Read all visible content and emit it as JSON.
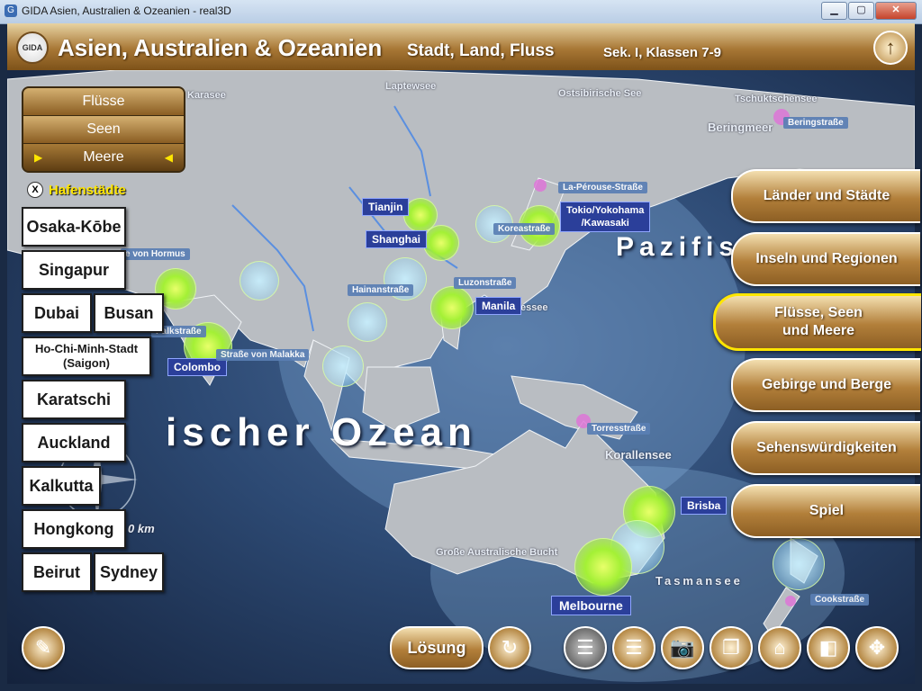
{
  "window": {
    "title": "GIDA Asien, Australien & Ozeanien - real3D",
    "minimize": "▁",
    "maximize": "▢",
    "close": "✕"
  },
  "header": {
    "logo": "GIDA",
    "title": "Asien, Australien & Ozeanien",
    "subtitle": "Stadt, Land, Fluss",
    "level": "Sek. I, Klassen 7-9",
    "up_icon": "↑"
  },
  "filters": {
    "items": [
      "Flüsse",
      "Seen",
      "Meere"
    ],
    "active": "Meere",
    "arrow_left": "▶",
    "arrow_right": "◀"
  },
  "category": {
    "close": "X",
    "label": "Hafenstädte"
  },
  "answers": {
    "osaka": "Osaka-Kōbe",
    "singapur": "Singapur",
    "dubai": "Dubai",
    "busan": "Busan",
    "hochiminh": "Ho-Chi-Minh-Stadt\n(Saigon)",
    "karatschi": "Karatschi",
    "auckland": "Auckland",
    "kalkutta": "Kalkutta",
    "hongkong": "Hongkong",
    "beirut": "Beirut",
    "sydney": "Sydney"
  },
  "nav": {
    "laender": "Länder und Städte",
    "inseln": "Inseln und Regionen",
    "fluesse": "Flüsse, Seen\nund Meere",
    "gebirge": "Gebirge und Berge",
    "sehens": "Sehenswürdigkeiten",
    "spiel": "Spiel",
    "active": "Flüsse, Seen und Meere"
  },
  "map": {
    "cities": {
      "tianjin": "Tianjin",
      "shanghai": "Shanghai",
      "tokio": "Tokio/Yokohama\n/Kawasaki",
      "manila": "Manila",
      "colombo": "Colombo",
      "brisbane": "Brisba",
      "melbourne": "Melbourne"
    },
    "straits": {
      "laperouse": "La-Pérouse-Straße",
      "korea": "Koreastraße",
      "luzon": "Luzonstraße",
      "hainan": "Hainanstraße",
      "hormus": "e von Hormus",
      "palk": "Palkstraße",
      "malakka": "Straße von Malakka",
      "torres": "Torresstraße",
      "cook": "Cookstraße"
    },
    "labels": {
      "laptew": "Laptewsee",
      "karasee": "Karasee",
      "ostsib": "Ostsibirische See",
      "tschuk": "Tschuktschensee",
      "bering_strait": "Beringstraße",
      "bering_sea": "Beringmeer",
      "korallen": "Korallensee",
      "tasman": "Tasmansee",
      "bucht": "Große Australische Bucht",
      "celebes": "Celebessee",
      "pazif": "Pazifis",
      "ozean": "ischer Ozean",
      "scale": "0 km"
    }
  },
  "toolbar": {
    "loesung": "Lösung",
    "notes_icon": "✎",
    "reset_icon": "↻",
    "list1_icon": "☰",
    "list2_icon": "☰",
    "camera_icon": "📷",
    "copy_icon": "❐",
    "home_icon": "⌂",
    "window_icon": "◧",
    "move_icon": "✥"
  }
}
